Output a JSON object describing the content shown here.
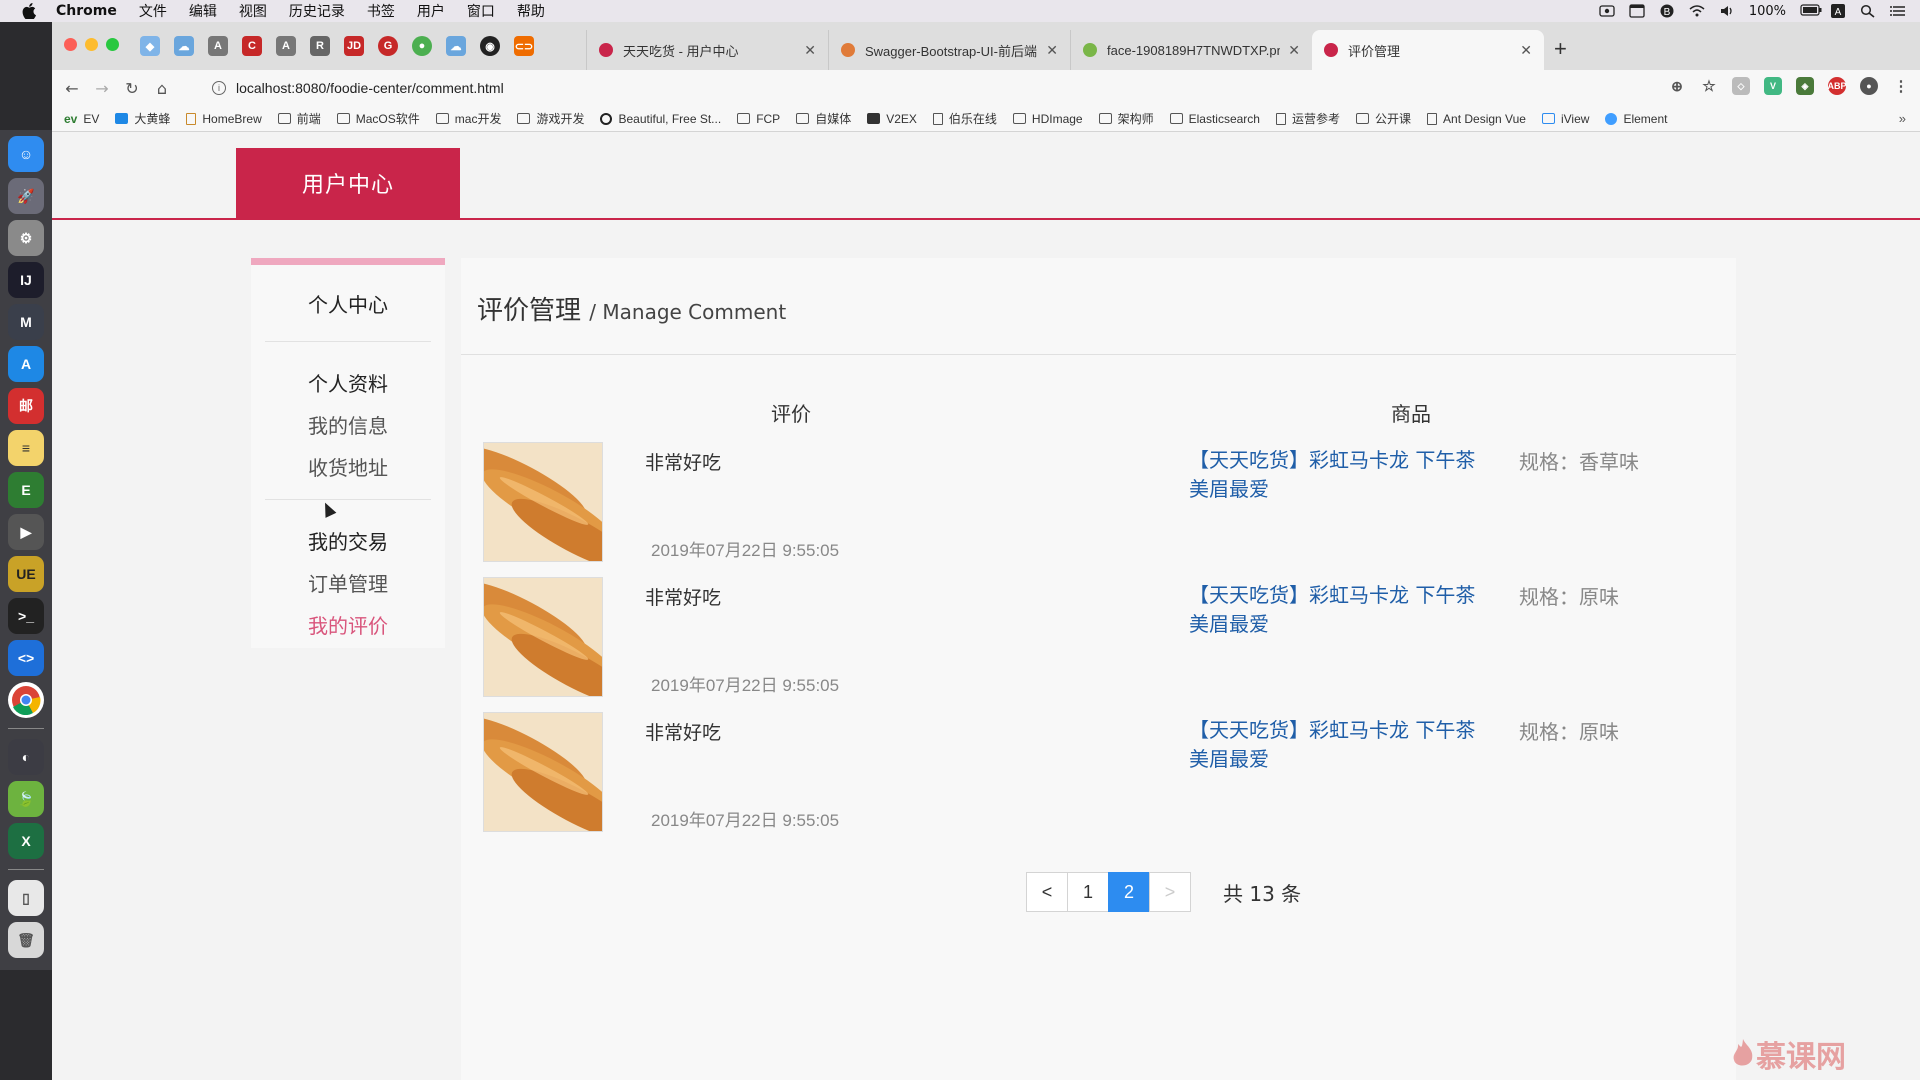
{
  "menubar": {
    "items": [
      "Chrome",
      "文件",
      "编辑",
      "视图",
      "历史记录",
      "书签",
      "用户",
      "窗口",
      "帮助"
    ],
    "battery": "100%"
  },
  "browser": {
    "tabs": [
      {
        "title": "天天吃货 - 用户中心",
        "favicon_color": "#c9254a"
      },
      {
        "title": "Swagger-Bootstrap-UI-前后端",
        "favicon_color": "#e07b39"
      },
      {
        "title": "face-1908189H7TNWDTXP.pn",
        "favicon_color": "#7ab648"
      },
      {
        "title": "评价管理",
        "favicon_color": "#c9254a"
      }
    ],
    "url": "localhost:8080/foodie-center/comment.html",
    "bookmarks": [
      "EV",
      "大黄蜂",
      "HomeBrew",
      "前端",
      "MacOS软件",
      "mac开发",
      "游戏开发",
      "Beautiful, Free St...",
      "FCP",
      "自媒体",
      "V2EX",
      "伯乐在线",
      "HDImage",
      "架构师",
      "Elasticsearch",
      "运营参考",
      "公开课",
      "Ant Design Vue",
      "iView",
      "Element"
    ]
  },
  "page": {
    "brand": "用户中心",
    "accent": "#c9254a",
    "sidebar": {
      "title": "个人中心",
      "profile_heading": "个人资料",
      "my_info": "我的信息",
      "address": "收货地址",
      "trade_heading": "我的交易",
      "orders": "订单管理",
      "comments": "我的评价"
    },
    "main": {
      "title": "评价管理",
      "subtitle": "/ Manage Comment",
      "col_comment": "评价",
      "col_product": "商品",
      "rows": [
        {
          "comment": "非常好吃",
          "time": "2019年07月22日 9:55:05",
          "product": "【天天吃货】彩虹马卡龙 下午茶 美眉最爱",
          "spec": "规格：香草味"
        },
        {
          "comment": "非常好吃",
          "time": "2019年07月22日 9:55:05",
          "product": "【天天吃货】彩虹马卡龙 下午茶 美眉最爱",
          "spec": "规格：原味"
        },
        {
          "comment": "非常好吃",
          "time": "2019年07月22日 9:55:05",
          "product": "【天天吃货】彩虹马卡龙 下午茶 美眉最爱",
          "spec": "规格：原味"
        }
      ],
      "pagination": {
        "prev": "<",
        "pages": [
          "1",
          "2"
        ],
        "current": "2",
        "next": ">",
        "total": "共 13 条"
      }
    }
  },
  "watermark": "慕课网"
}
